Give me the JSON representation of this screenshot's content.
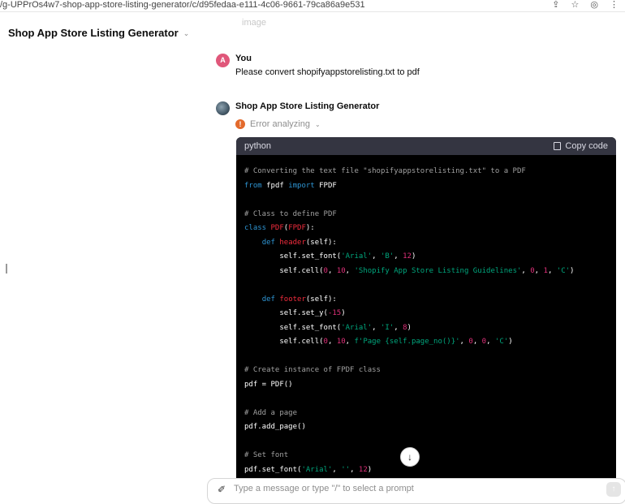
{
  "browser": {
    "url": "/g-UPPrOs4w7-shop-app-store-listing-generator/c/d95fedaa-e111-4c06-9661-79ca86a9e531",
    "icons": [
      "share-icon",
      "star-icon",
      "globe-icon",
      "menu-icon"
    ]
  },
  "header": {
    "title": "Shop App Store Listing Generator"
  },
  "faded_text": "image",
  "messages": {
    "user": {
      "avatar_letter": "A",
      "name": "You",
      "text": "Please convert shopifyappstorelisting.txt to pdf"
    },
    "bot": {
      "name": "Shop App Store Listing Generator",
      "status": "Error analyzing",
      "status_icon": "!"
    }
  },
  "code": {
    "language": "python",
    "copy_label": "Copy code",
    "lines": [
      [
        {
          "t": "# Converting the text file \"shopifyappstorelisting.txt\" to a PDF",
          "c": "comment"
        }
      ],
      [
        {
          "t": "from",
          "c": "kw"
        },
        {
          "t": " fpdf ",
          "c": ""
        },
        {
          "t": "import",
          "c": "kw"
        },
        {
          "t": " FPDF",
          "c": ""
        }
      ],
      [],
      [
        {
          "t": "# Class to define PDF",
          "c": "comment"
        }
      ],
      [
        {
          "t": "class",
          "c": "kw"
        },
        {
          "t": " ",
          "c": ""
        },
        {
          "t": "PDF",
          "c": "fn"
        },
        {
          "t": "(",
          "c": ""
        },
        {
          "t": "FPDF",
          "c": "fn"
        },
        {
          "t": "):",
          "c": ""
        }
      ],
      [
        {
          "t": "    ",
          "c": ""
        },
        {
          "t": "def",
          "c": "kw"
        },
        {
          "t": " ",
          "c": ""
        },
        {
          "t": "header",
          "c": "fn"
        },
        {
          "t": "(self):",
          "c": ""
        }
      ],
      [
        {
          "t": "        self.set_font(",
          "c": ""
        },
        {
          "t": "'Arial'",
          "c": "str"
        },
        {
          "t": ", ",
          "c": ""
        },
        {
          "t": "'B'",
          "c": "str"
        },
        {
          "t": ", ",
          "c": ""
        },
        {
          "t": "12",
          "c": "num"
        },
        {
          "t": ")",
          "c": ""
        }
      ],
      [
        {
          "t": "        self.cell(",
          "c": ""
        },
        {
          "t": "0",
          "c": "num"
        },
        {
          "t": ", ",
          "c": ""
        },
        {
          "t": "10",
          "c": "num"
        },
        {
          "t": ", ",
          "c": ""
        },
        {
          "t": "'Shopify App Store Listing Guidelines'",
          "c": "str"
        },
        {
          "t": ", ",
          "c": ""
        },
        {
          "t": "0",
          "c": "num"
        },
        {
          "t": ", ",
          "c": ""
        },
        {
          "t": "1",
          "c": "num"
        },
        {
          "t": ", ",
          "c": ""
        },
        {
          "t": "'C'",
          "c": "str"
        },
        {
          "t": ")",
          "c": ""
        }
      ],
      [],
      [
        {
          "t": "    ",
          "c": ""
        },
        {
          "t": "def",
          "c": "kw"
        },
        {
          "t": " ",
          "c": ""
        },
        {
          "t": "footer",
          "c": "fn"
        },
        {
          "t": "(self):",
          "c": ""
        }
      ],
      [
        {
          "t": "        self.set_y(",
          "c": ""
        },
        {
          "t": "-15",
          "c": "num"
        },
        {
          "t": ")",
          "c": ""
        }
      ],
      [
        {
          "t": "        self.set_font(",
          "c": ""
        },
        {
          "t": "'Arial'",
          "c": "str"
        },
        {
          "t": ", ",
          "c": ""
        },
        {
          "t": "'I'",
          "c": "str"
        },
        {
          "t": ", ",
          "c": ""
        },
        {
          "t": "8",
          "c": "num"
        },
        {
          "t": ")",
          "c": ""
        }
      ],
      [
        {
          "t": "        self.cell(",
          "c": ""
        },
        {
          "t": "0",
          "c": "num"
        },
        {
          "t": ", ",
          "c": ""
        },
        {
          "t": "10",
          "c": "num"
        },
        {
          "t": ", ",
          "c": ""
        },
        {
          "t": "f'Page {self.page_no()}'",
          "c": "str"
        },
        {
          "t": ", ",
          "c": ""
        },
        {
          "t": "0",
          "c": "num"
        },
        {
          "t": ", ",
          "c": ""
        },
        {
          "t": "0",
          "c": "num"
        },
        {
          "t": ", ",
          "c": ""
        },
        {
          "t": "'C'",
          "c": "str"
        },
        {
          "t": ")",
          "c": ""
        }
      ],
      [],
      [
        {
          "t": "# Create instance of FPDF class",
          "c": "comment"
        }
      ],
      [
        {
          "t": "pdf = PDF()",
          "c": ""
        }
      ],
      [],
      [
        {
          "t": "# Add a page",
          "c": "comment"
        }
      ],
      [
        {
          "t": "pdf.add_page()",
          "c": ""
        }
      ],
      [],
      [
        {
          "t": "# Set font",
          "c": "comment"
        }
      ],
      [
        {
          "t": "pdf.set_font(",
          "c": ""
        },
        {
          "t": "'Arial'",
          "c": "str"
        },
        {
          "t": ", ",
          "c": ""
        },
        {
          "t": "''",
          "c": "str"
        },
        {
          "t": ", ",
          "c": ""
        },
        {
          "t": "12",
          "c": "num"
        },
        {
          "t": ")",
          "c": ""
        }
      ]
    ]
  },
  "input": {
    "placeholder": "Type a message or type \"/\" to select a prompt"
  },
  "colors": {
    "code_bg": "#000000",
    "code_header_bg": "#343541",
    "keyword": "#2e95d3",
    "function": "#f22c3d",
    "string": "#00a67d",
    "number": "#df3079",
    "comment": "#a0a0a0",
    "error": "#e36a2c",
    "user_avatar": "#e0577a"
  }
}
